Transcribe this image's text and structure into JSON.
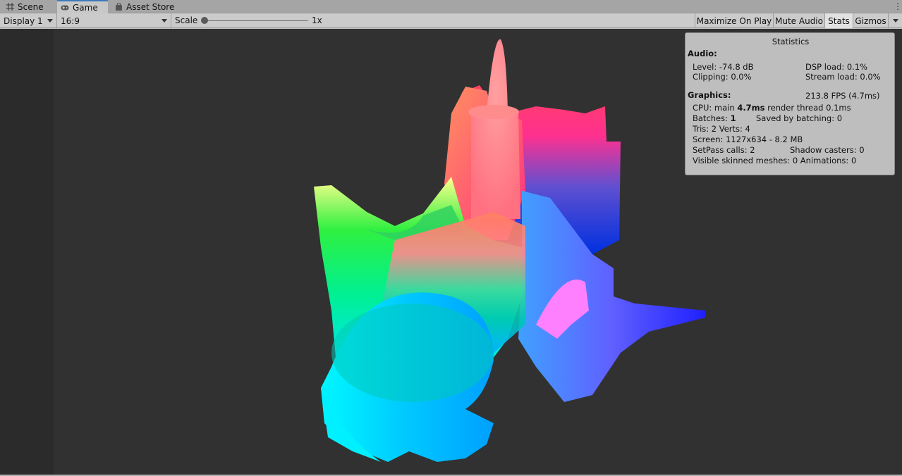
{
  "tabs": [
    {
      "label": "Scene",
      "icon": "grid-icon"
    },
    {
      "label": "Game",
      "icon": "gamepad-icon",
      "active": true
    },
    {
      "label": "Asset Store",
      "icon": "bag-icon"
    }
  ],
  "toolbar": {
    "display": "Display 1",
    "aspect": "16:9",
    "scale_label": "Scale",
    "scale_value": "1x",
    "maximize": "Maximize On Play",
    "mute": "Mute Audio",
    "stats": "Stats",
    "gizmos": "Gizmos"
  },
  "stats": {
    "title": "Statistics",
    "audio_header": "Audio:",
    "level": "Level: -74.8 dB",
    "clipping": "Clipping: 0.0%",
    "dsp": "DSP load: 0.1%",
    "stream": "Stream load: 0.0%",
    "graphics_header": "Graphics:",
    "fps": "213.8 FPS (4.7ms)",
    "cpu_prefix": "CPU: main ",
    "cpu_main": "4.7ms",
    "cpu_suffix": "  render thread 0.1ms",
    "batches_prefix": "Batches: ",
    "batches_value": "1",
    "saved": "Saved by batching: 0",
    "tris": "Tris: 2   Verts: 4",
    "screen": "Screen: 1127x634 - 8.2 MB",
    "setpass": "SetPass calls: 2",
    "shadow": "Shadow casters: 0",
    "skinned": "Visible skinned meshes: 0  Animations: 0"
  },
  "colors": {
    "game_bg": "#313131",
    "toolbar_bg": "#cbcbcb",
    "tab_active_accent": "#3a79bb"
  }
}
